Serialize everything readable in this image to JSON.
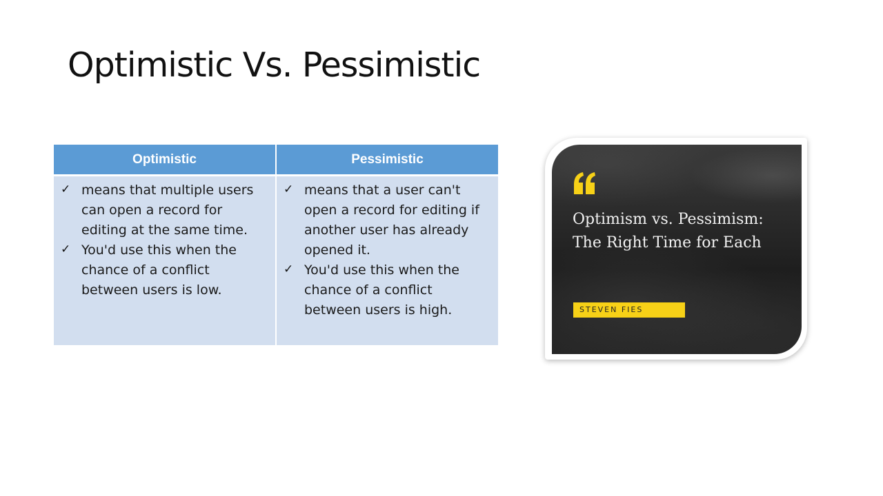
{
  "slide": {
    "title": "Optimistic Vs. Pessimistic"
  },
  "table": {
    "columns": [
      {
        "header": "Optimistic",
        "bullets": [
          "means that multiple users can open a record for editing at the same time.",
          "You'd use this when the chance of a conflict between users is low."
        ]
      },
      {
        "header": "Pessimistic",
        "bullets": [
          "means that a user can't open a record for editing if another user has already opened it.",
          "You'd use this when the chance of a conflict between users is high."
        ]
      }
    ],
    "bullet_icon": "check-icon",
    "colors": {
      "header_bg": "#5b9bd5",
      "header_text": "#ffffff",
      "cell_bg": "#d2deef"
    }
  },
  "card": {
    "title_line1": "Optimism vs. Pessimism:",
    "title_line2": "The Right Time for Each",
    "author": "STEVEN FIES",
    "quote_icon": "quote-icon",
    "colors": {
      "accent": "#f7d117",
      "background": "#2a2a2a",
      "title_text": "#f2f2f2"
    }
  }
}
